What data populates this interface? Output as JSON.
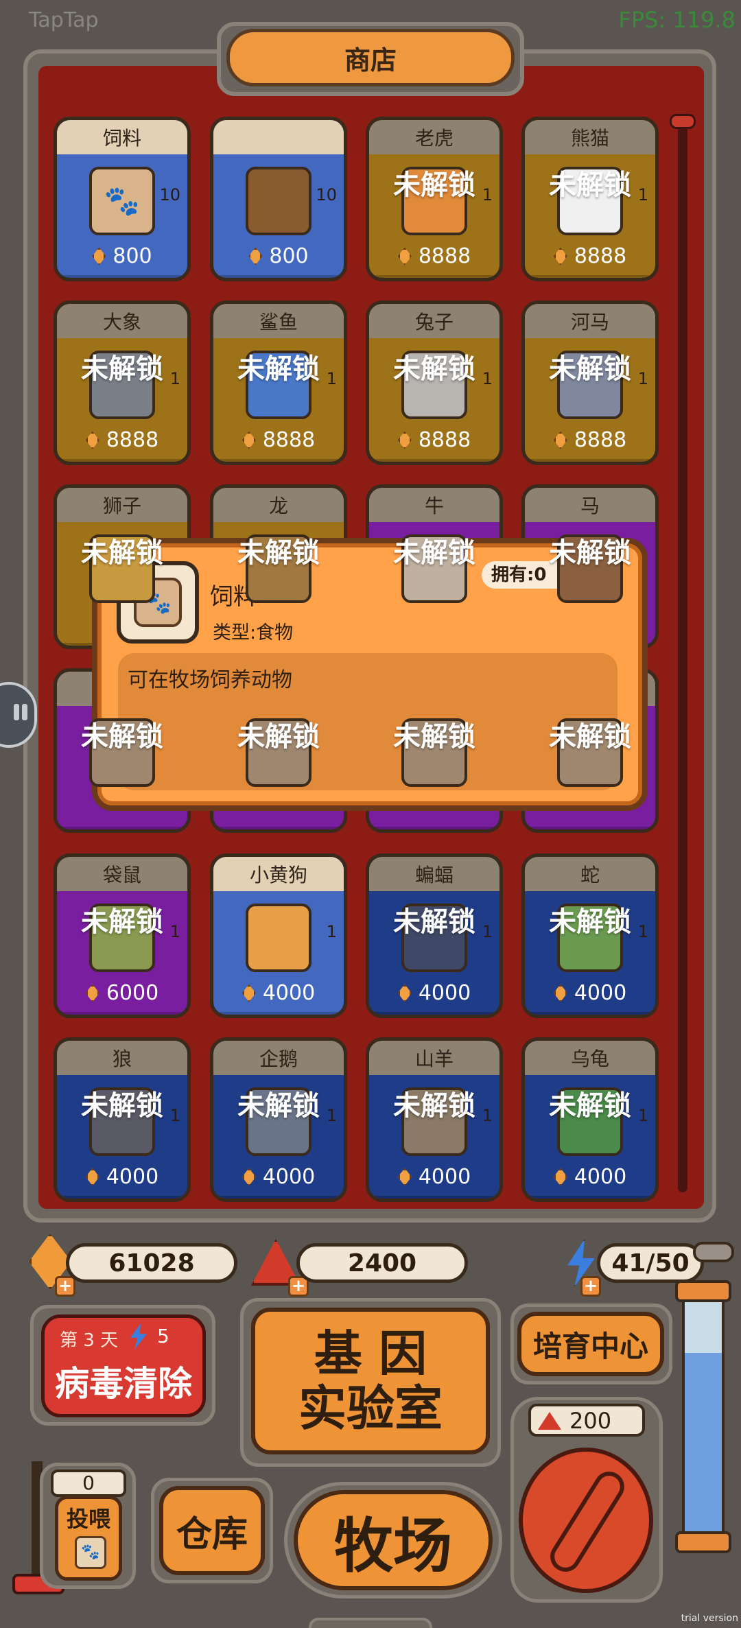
{
  "overlay": {
    "taptap": "TapTap",
    "fps": "FPS: 119.8",
    "trial": "trial version"
  },
  "shop": {
    "title": "商店",
    "locked_label": "未解锁",
    "cards": [
      {
        "name": "饲料",
        "price": "800",
        "count": "10",
        "locked": false,
        "theme": "blue",
        "art": "feed-sack-icon"
      },
      {
        "name": "",
        "price": "800",
        "count": "10",
        "locked": false,
        "theme": "blue",
        "art": "poop-icon"
      },
      {
        "name": "老虎",
        "price": "8888",
        "count": "1",
        "locked": true,
        "theme": "gold",
        "art": "tiger-icon"
      },
      {
        "name": "熊猫",
        "price": "8888",
        "count": "1",
        "locked": true,
        "theme": "gold",
        "art": "panda-icon"
      },
      {
        "name": "大象",
        "price": "8888",
        "count": "1",
        "locked": true,
        "theme": "gold",
        "art": "elephant-icon"
      },
      {
        "name": "鲨鱼",
        "price": "8888",
        "count": "1",
        "locked": true,
        "theme": "gold",
        "art": "shark-icon"
      },
      {
        "name": "兔子",
        "price": "8888",
        "count": "1",
        "locked": true,
        "theme": "gold",
        "art": "rabbit-icon"
      },
      {
        "name": "河马",
        "price": "8888",
        "count": "1",
        "locked": true,
        "theme": "gold",
        "art": "hippo-icon"
      },
      {
        "name": "狮子",
        "price": "",
        "count": "",
        "locked": true,
        "theme": "gold",
        "art": "lion-icon"
      },
      {
        "name": "龙",
        "price": "",
        "count": "",
        "locked": true,
        "theme": "gold",
        "art": "dragon-icon"
      },
      {
        "name": "牛",
        "price": "",
        "count": "",
        "locked": true,
        "theme": "purple",
        "art": "cow-icon"
      },
      {
        "name": "马",
        "price": "",
        "count": "",
        "locked": true,
        "theme": "purple",
        "art": "horse-icon"
      },
      {
        "name": "",
        "price": "",
        "count": "",
        "locked": true,
        "theme": "purple",
        "art": "animal-icon"
      },
      {
        "name": "",
        "price": "",
        "count": "",
        "locked": true,
        "theme": "purple",
        "art": "animal-icon"
      },
      {
        "name": "",
        "price": "",
        "count": "",
        "locked": true,
        "theme": "purple",
        "art": "animal-icon"
      },
      {
        "name": "",
        "price": "",
        "count": "",
        "locked": true,
        "theme": "purple",
        "art": "animal-icon"
      },
      {
        "name": "袋鼠",
        "price": "6000",
        "count": "1",
        "locked": true,
        "theme": "purple",
        "art": "kangaroo-icon"
      },
      {
        "name": "小黄狗",
        "price": "4000",
        "count": "1",
        "locked": false,
        "theme": "blue",
        "art": "dog-icon"
      },
      {
        "name": "蝙蝠",
        "price": "4000",
        "count": "1",
        "locked": true,
        "theme": "navy",
        "art": "bat-icon"
      },
      {
        "name": "蛇",
        "price": "4000",
        "count": "1",
        "locked": true,
        "theme": "navy",
        "art": "snake-icon"
      },
      {
        "name": "狼",
        "price": "4000",
        "count": "1",
        "locked": true,
        "theme": "navy",
        "art": "wolf-icon"
      },
      {
        "name": "企鹅",
        "price": "4000",
        "count": "1",
        "locked": true,
        "theme": "navy",
        "art": "penguin-icon"
      },
      {
        "name": "山羊",
        "price": "4000",
        "count": "1",
        "locked": true,
        "theme": "navy",
        "art": "goat-icon"
      },
      {
        "name": "乌龟",
        "price": "4000",
        "count": "1",
        "locked": true,
        "theme": "navy",
        "art": "turtle-icon"
      }
    ]
  },
  "popup": {
    "name": "饲料",
    "type": "类型:食物",
    "owned": "拥有:0",
    "description": "可在牧场饲养动物",
    "icon": "feed-sack-icon"
  },
  "resources": {
    "gems": "61028",
    "rubies": "2400",
    "energy": "41/50",
    "plus": "+"
  },
  "controls": {
    "virus": {
      "day": "第 3 天",
      "energy_cost": "5",
      "label": "病毒清除"
    },
    "gene_lab": {
      "line1": "基 因",
      "line2": "实验室"
    },
    "breeding": "培育中心",
    "feed": {
      "count": "0",
      "label": "投喂"
    },
    "warehouse": "仓库",
    "ranch": "牧场",
    "gauge_cost": "200"
  },
  "colors": {
    "blue_header": "#e2d1b4",
    "blue_body": "#4268c0",
    "gold_header": "#8e8270",
    "gold_body": "#9e7218",
    "purple_header": "#8e8270",
    "purple_body": "#7a1ea0",
    "navy_header": "#8e8270",
    "navy_body": "#1f3c88"
  }
}
